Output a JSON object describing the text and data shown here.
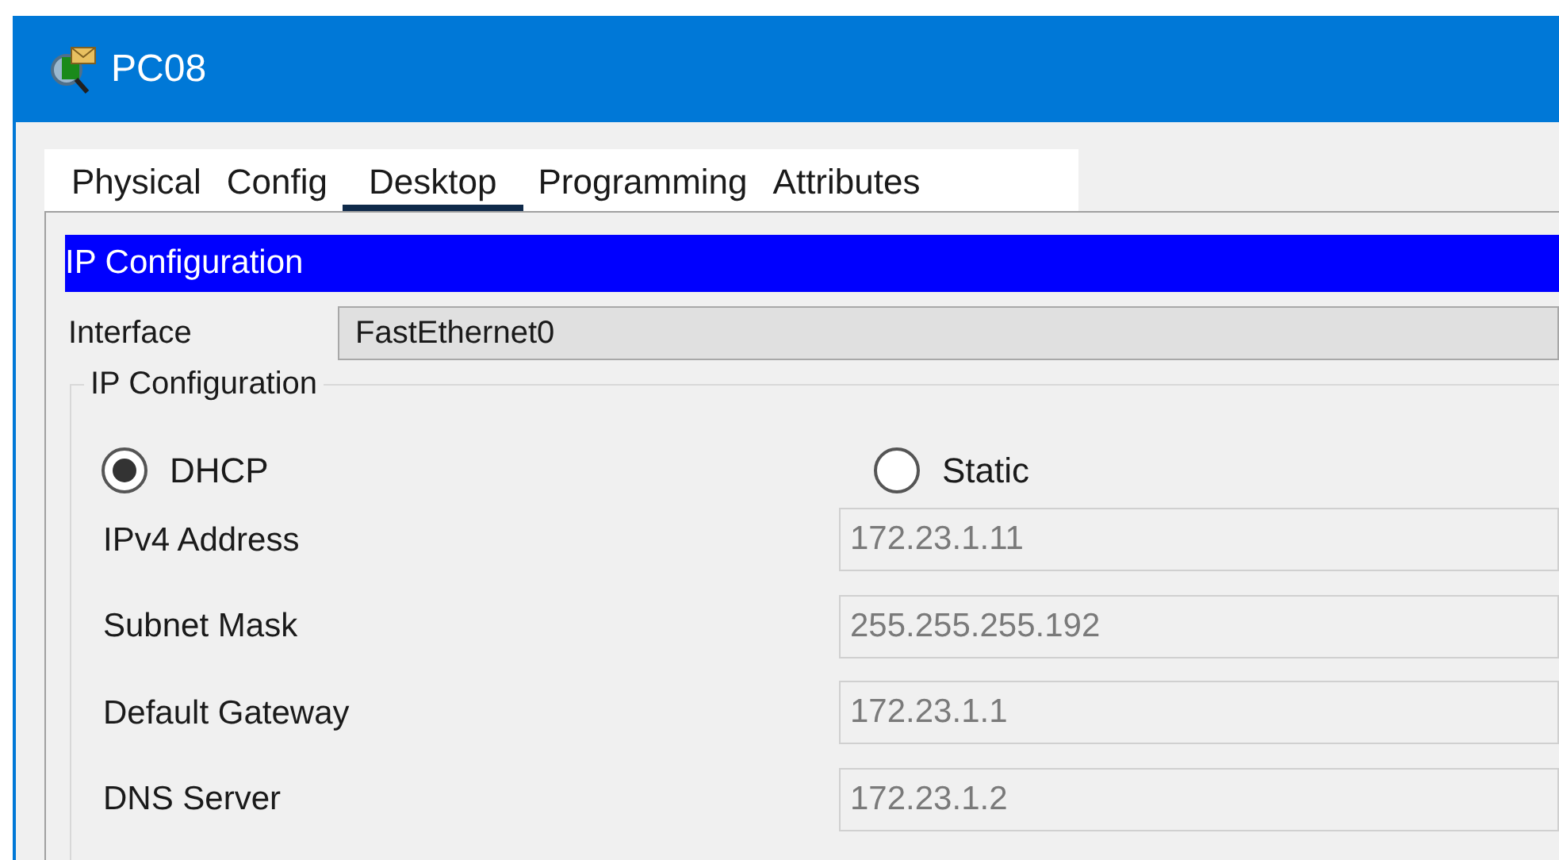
{
  "window": {
    "title": "PC08"
  },
  "tabs": [
    {
      "label": "Physical",
      "selected": false
    },
    {
      "label": "Config",
      "selected": false
    },
    {
      "label": "Desktop",
      "selected": true
    },
    {
      "label": "Programming",
      "selected": false
    },
    {
      "label": "Attributes",
      "selected": false
    }
  ],
  "panel_header": "IP Configuration",
  "interface": {
    "label": "Interface",
    "value": "FastEthernet0"
  },
  "group": {
    "title": "IP Configuration",
    "modes": [
      {
        "label": "DHCP",
        "selected": true
      },
      {
        "label": "Static",
        "selected": false
      }
    ],
    "fields": [
      {
        "label": "IPv4 Address",
        "value": "172.23.1.11",
        "disabled": true
      },
      {
        "label": "Subnet Mask",
        "value": "255.255.255.192",
        "disabled": true
      },
      {
        "label": "Default Gateway",
        "value": "172.23.1.1",
        "disabled": true
      },
      {
        "label": "DNS Server",
        "value": "172.23.1.2",
        "disabled": true
      }
    ]
  }
}
